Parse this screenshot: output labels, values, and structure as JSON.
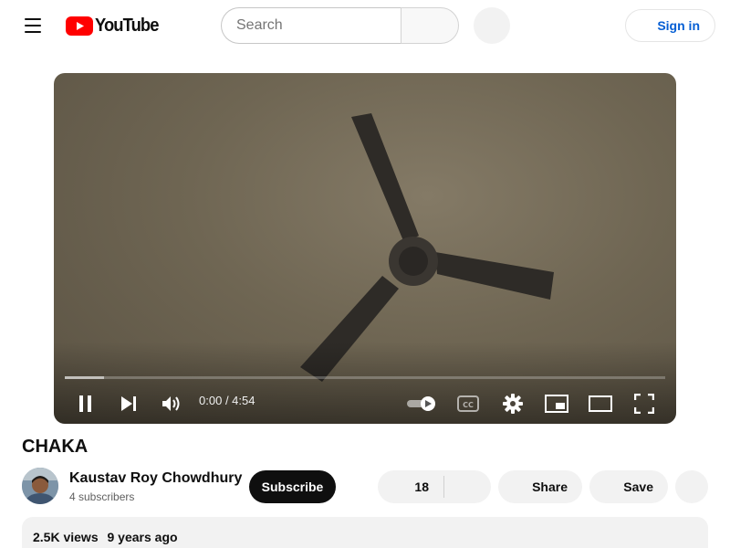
{
  "header": {
    "logo_text": "YouTube",
    "search_placeholder": "Search",
    "signin_label": "Sign in"
  },
  "player": {
    "time_current": "0:00",
    "time_total": "4:54",
    "buffered_fraction": 0.065
  },
  "video": {
    "title": "CHAKA",
    "channel_name": "Kaustav Roy Chowdhury",
    "subscribers": "4 subscribers",
    "subscribe_label": "Subscribe",
    "likes": "18",
    "share_label": "Share",
    "save_label": "Save",
    "views": "2.5K views",
    "published": "9 years ago"
  },
  "colors": {
    "brand_red": "#ff0000",
    "link_blue": "#065fd4"
  }
}
